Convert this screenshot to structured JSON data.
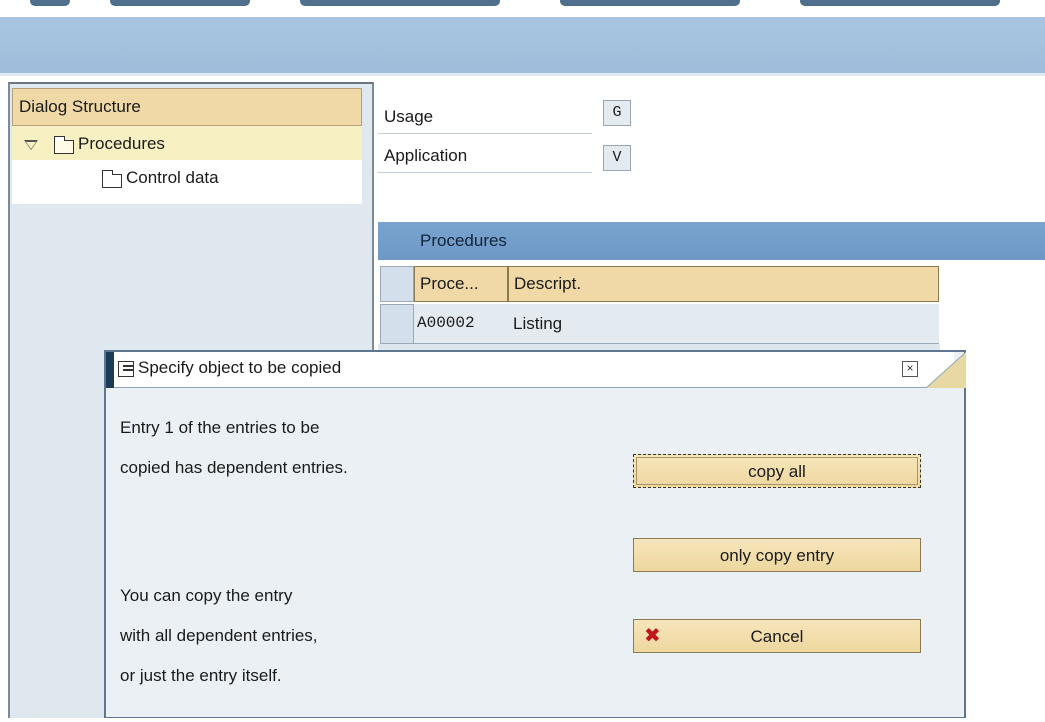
{
  "tree": {
    "header": "Dialog Structure",
    "items": [
      {
        "label": "Procedures"
      },
      {
        "label": "Control data"
      }
    ]
  },
  "fields": {
    "usage_label": "Usage",
    "usage_value": "G",
    "application_label": "Application",
    "application_value": "V"
  },
  "procedures_table": {
    "title": "Procedures",
    "columns": [
      "Proce...",
      "Descript."
    ],
    "rows": [
      {
        "code": "A00002",
        "description": "Listing"
      }
    ]
  },
  "dialog": {
    "title": "Specify object to be copied",
    "line1": "Entry 1  of the entries to be",
    "line2": "copied has dependent entries.",
    "line3": "You can copy the entry",
    "line4": "with all dependent entries,",
    "line5": "or just the entry itself.",
    "close_symbol": "×",
    "buttons": {
      "copy_all": "copy all",
      "only_copy_entry": "only copy entry",
      "cancel": "Cancel",
      "cancel_icon": "✖"
    }
  },
  "colors": {
    "toolbar": "#a8c4e0",
    "header_gold": "#f0d9a6",
    "table_header_blue": "#7aa3cf",
    "cancel_red": "#c2141b"
  }
}
